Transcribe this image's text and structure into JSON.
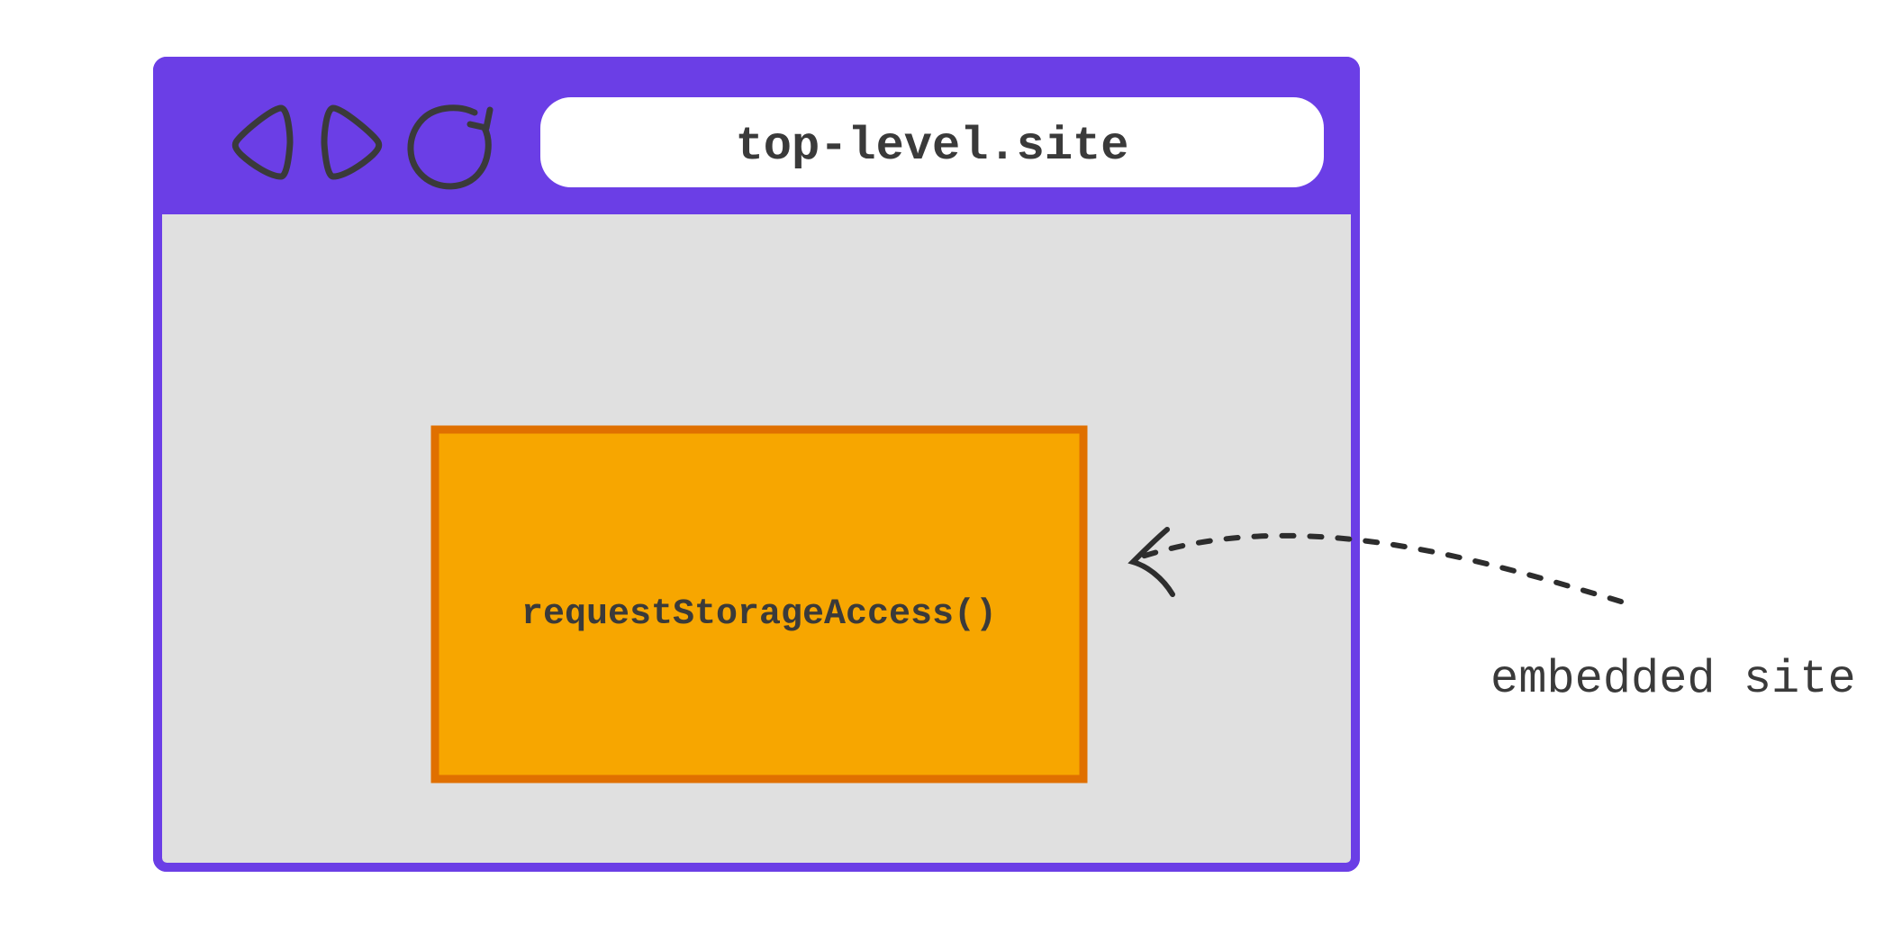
{
  "browser": {
    "url": "top-level.site",
    "embed_call": "requestStorageAccess()"
  },
  "annotation": {
    "label": "embedded site"
  },
  "colors": {
    "page_bg": "#ffffff",
    "toolbar_bg": "#6b3ee6",
    "browser_border": "#6b3ee6",
    "content_bg": "#e0e0e0",
    "url_bg": "#ffffff",
    "icon_stroke": "#3a3a3a",
    "iframe_bg": "#f7a600",
    "iframe_border": "#e07000",
    "text_dark": "#3a3a3a",
    "arrow": "#2d2d2d"
  }
}
